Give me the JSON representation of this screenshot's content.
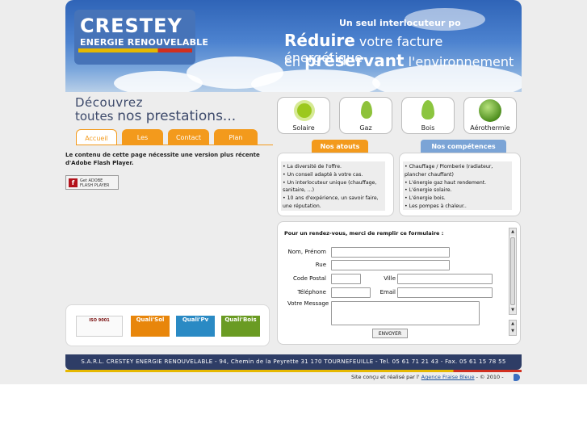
{
  "header": {
    "logo_title": "CRESTEY",
    "logo_subtitle": "ENERGIE RENOUVELABLE",
    "slogan_top": "Un seul interlocuteur po",
    "slogan_line1_strong": "Réduire",
    "slogan_line1_rest": " votre facture énergétique",
    "slogan_line2_pre": "en ",
    "slogan_line2_strong": "préservant",
    "slogan_line2_rest": " l'environnement"
  },
  "intro": {
    "line1": "Découvrez",
    "line2_pre": "toutes ",
    "line2_strong": "nos prestations..."
  },
  "nav": {
    "items": [
      "Accueil",
      "Les aides",
      "Contact",
      "Plan d'accès"
    ]
  },
  "flash": {
    "message": "Le contenu de cette page nécessite une version plus récente d'Adobe Flash Player.",
    "badge_line1": "Get ADOBE",
    "badge_line2": "FLASH PLAYER"
  },
  "services": [
    {
      "label": "Solaire",
      "icon": "sun-icon"
    },
    {
      "label": "Gaz",
      "icon": "gas-drop-icon"
    },
    {
      "label": "Bois",
      "icon": "wood-flame-icon"
    },
    {
      "label": "Aérothermie",
      "icon": "globe-icon"
    }
  ],
  "atouts": {
    "title": "Nos atouts",
    "items": [
      "• La diversité de l'offre.",
      "• Un conseil adapté à votre cas.",
      "• Un interlocuteur unique (chauffage, sanitaire, ...)",
      "• 10 ans d'expérience, un savoir faire, une réputation."
    ]
  },
  "competences": {
    "title": "Nos compétences",
    "items": [
      "• Chauffage / Plomberie (radiateur, plancher chauffant)",
      "• L'énergie gaz haut rendement.",
      "• L'énergie solaire.",
      "• L'énergie bois.",
      "• Les pompes à chaleur.."
    ]
  },
  "form": {
    "title": "Pour un rendez-vous, merci de remplir ce formulaire :",
    "labels": {
      "name": "Nom, Prénom",
      "street": "Rue",
      "zip": "Code Postal",
      "city": "Ville",
      "phone": "Téléphone",
      "email": "Email",
      "message": "Votre Message"
    },
    "submit": "ENVOYER"
  },
  "certifications": {
    "iso": "ISO 9001",
    "sol": "Quali'Sol",
    "pv": "Quali'Pv",
    "bois": "Quali'Bois"
  },
  "footer": {
    "text": "S.A.R.L. CRESTEY ENERGIE RENOUVELABLE - 94, Chemin de la Peyrette 31 170 TOURNEFEUILLE - Tel. 05 61 71 21 43 - Fax. 05 61 15 78 55",
    "credits_pre": "Site conçu et réalisé par l' ",
    "credits_link": "Agence Fraise Bleue",
    "credits_post": " - © 2010 -"
  },
  "colors": {
    "accent_orange": "#f39a1c",
    "accent_blue": "#7ba4d6",
    "footer_navy": "#2e3d66"
  }
}
